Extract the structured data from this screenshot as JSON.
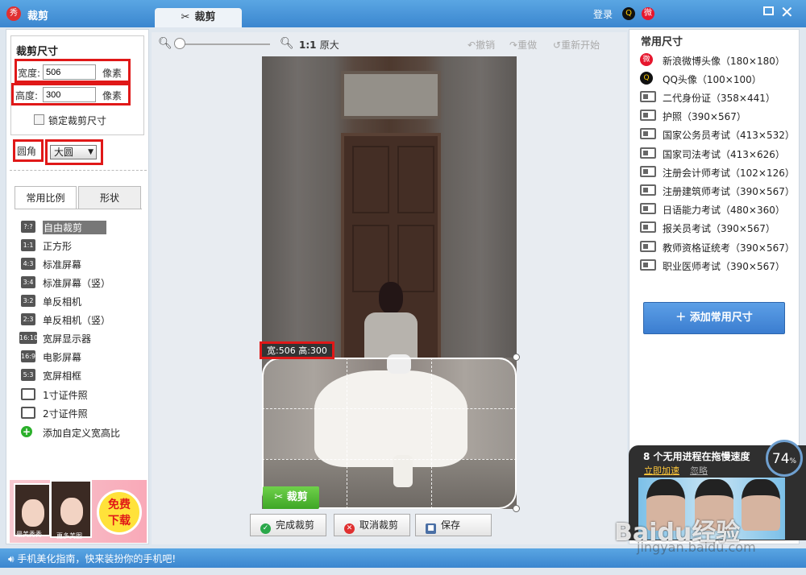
{
  "app": {
    "title": "裁剪",
    "tab_label": "裁剪",
    "login_label": "登录"
  },
  "crop_size": {
    "title": "裁剪尺寸",
    "width_label": "宽度:",
    "width_value": "506",
    "height_label": "高度:",
    "height_value": "300",
    "unit": "像素",
    "lock_label": "锁定裁剪尺寸",
    "lock_checked": false,
    "round_label": "圆角",
    "round_value": "大圆"
  },
  "left_tabs": [
    "常用比例",
    "形状"
  ],
  "ratios": [
    {
      "badge": "?:?",
      "label": "自由裁剪",
      "selected": true
    },
    {
      "badge": "1:1",
      "label": "正方形"
    },
    {
      "badge": "4:3",
      "label": "标准屏幕"
    },
    {
      "badge": "3:4",
      "label": "标准屏幕（竖）"
    },
    {
      "badge": "3:2",
      "label": "单反相机"
    },
    {
      "badge": "2:3",
      "label": "单反相机（竖）"
    },
    {
      "badge": "16:10",
      "label": "宽屏显示器"
    },
    {
      "badge": "16:9",
      "label": "电影屏幕"
    },
    {
      "badge": "5:3",
      "label": "宽屏相框"
    },
    {
      "badge": "id-card-icon",
      "label": "1寸证件照"
    },
    {
      "badge": "id-card-icon",
      "label": "2寸证件照"
    },
    {
      "badge": "plus-icon",
      "label": "添加自定义宽高比"
    }
  ],
  "ad": {
    "badge_line1": "免费",
    "badge_line2": "下载",
    "caption1": "最美秀秀",
    "caption2": "更多美图"
  },
  "toolbar": {
    "ratio_11": "1:1",
    "original_label": "原大",
    "undo_label": "撤销",
    "redo_label": "重做",
    "restart_label": "重新开始"
  },
  "canvas": {
    "dim_label": "宽:506 高:300",
    "crop_button": "裁剪"
  },
  "actions": {
    "done": "完成裁剪",
    "cancel": "取消裁剪",
    "save": "保存"
  },
  "presets": {
    "title": "常用尺寸",
    "items": [
      {
        "icon": "weibo-icon",
        "label": "新浪微博头像（180×180）"
      },
      {
        "icon": "qq-icon",
        "label": "QQ头像（100×100）"
      },
      {
        "icon": "id-card-icon",
        "label": "二代身份证（358×441）"
      },
      {
        "icon": "id-card-icon",
        "label": "护照（390×567）"
      },
      {
        "icon": "id-card-icon",
        "label": "国家公务员考试（413×532）"
      },
      {
        "icon": "id-card-icon",
        "label": "国家司法考试（413×626）"
      },
      {
        "icon": "id-card-icon",
        "label": "注册会计师考试（102×126）"
      },
      {
        "icon": "id-card-icon",
        "label": "注册建筑师考试（390×567）"
      },
      {
        "icon": "id-card-icon",
        "label": "日语能力考试（480×360）"
      },
      {
        "icon": "id-card-icon",
        "label": "报关员考试（390×567）"
      },
      {
        "icon": "id-card-icon",
        "label": "教师资格证统考（390×567）"
      },
      {
        "icon": "id-card-icon",
        "label": "职业医师考试（390×567）"
      }
    ],
    "add_button": "添加常用尺寸"
  },
  "popup": {
    "title": "8 个无用进程在拖慢速度",
    "accelerate": "立即加速",
    "ignore": "忽略",
    "gauge_value": "74",
    "gauge_unit": "%"
  },
  "status": {
    "text": "手机美化指南，快来装扮你的手机吧!"
  },
  "watermark": {
    "line1": "Baidu经验",
    "line2": "jingyan.baidu.com"
  },
  "colors": {
    "accent": "#3b86cf",
    "highlight_red": "#e01818",
    "crop_green": "#3ea626"
  }
}
